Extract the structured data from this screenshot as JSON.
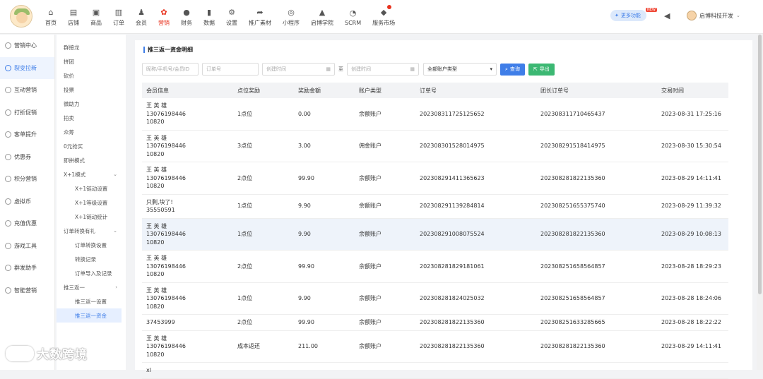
{
  "nav": [
    {
      "label": "首页",
      "icon": "home-icon",
      "glyph": "⌂"
    },
    {
      "label": "店铺",
      "icon": "store-icon",
      "glyph": "▤"
    },
    {
      "label": "商品",
      "icon": "goods-icon",
      "glyph": "▣"
    },
    {
      "label": "订单",
      "icon": "order-icon",
      "glyph": "▥"
    },
    {
      "label": "会员",
      "icon": "member-icon",
      "glyph": "♟"
    },
    {
      "label": "营销",
      "icon": "marketing-icon",
      "glyph": "✿",
      "active": true
    },
    {
      "label": "财务",
      "icon": "finance-icon",
      "glyph": "●"
    },
    {
      "label": "数据",
      "icon": "data-icon",
      "glyph": "▮"
    },
    {
      "label": "设置",
      "icon": "settings-icon",
      "glyph": "⚙"
    },
    {
      "label": "推广素材",
      "icon": "share-icon",
      "glyph": "➦"
    },
    {
      "label": "小程序",
      "icon": "miniapp-icon",
      "glyph": "◎"
    },
    {
      "label": "启博学院",
      "icon": "academy-icon",
      "glyph": "▲"
    },
    {
      "label": "SCRM",
      "icon": "scrm-icon",
      "glyph": "◔"
    },
    {
      "label": "服务市场",
      "icon": "service-market-icon",
      "glyph": "◆"
    }
  ],
  "header": {
    "more": "更多功能",
    "new": "NEW",
    "user": "启博科技开发"
  },
  "sidebar": [
    {
      "label": "营销中心"
    },
    {
      "label": "裂变拉新",
      "active": true
    },
    {
      "label": "互动营销"
    },
    {
      "label": "打折促销"
    },
    {
      "label": "客单提升"
    },
    {
      "label": "优惠券"
    },
    {
      "label": "积分营销"
    },
    {
      "label": "虚拟币"
    },
    {
      "label": "充值优惠"
    },
    {
      "label": "游戏工具"
    },
    {
      "label": "群发助手"
    },
    {
      "label": "智能营销"
    }
  ],
  "subnav": [
    {
      "label": "群接龙"
    },
    {
      "label": "拼团"
    },
    {
      "label": "砍价"
    },
    {
      "label": "投票"
    },
    {
      "label": "微助力"
    },
    {
      "label": "拍卖"
    },
    {
      "label": "众筹"
    },
    {
      "label": "0元抢买"
    },
    {
      "label": "即拼模式"
    },
    {
      "label": "X+1模式",
      "chev": "⌄"
    },
    {
      "label": "X+1链动设置",
      "child": true
    },
    {
      "label": "X+1等级设置",
      "child": true
    },
    {
      "label": "X+1链动统计",
      "child": true
    },
    {
      "label": "订单转换有礼",
      "chev": "⌄"
    },
    {
      "label": "订单转换设置",
      "child": true
    },
    {
      "label": "转换记录",
      "child": true
    },
    {
      "label": "订单导入及记录",
      "child": true
    },
    {
      "label": "推三返一",
      "chev": "›"
    },
    {
      "label": "推三返一设置",
      "child": true
    },
    {
      "label": "推三返一资金",
      "child": true,
      "active": true
    }
  ],
  "page": {
    "title": "推三返一资金明细",
    "filters": {
      "member_placeholder": "昵称/手机号/会员ID",
      "order_placeholder": "订单号",
      "start_placeholder": "创建时间",
      "to": "至",
      "end_placeholder": "创建时间",
      "account_type": "全部账户类型",
      "search": "查询",
      "export": "导出"
    },
    "columns": [
      "会员信息",
      "点位奖励",
      "奖励金额",
      "账户类型",
      "订单号",
      "团长订单号",
      "交易时间"
    ],
    "rows": [
      {
        "member": [
          "王 英 雄",
          "13076198446",
          "10820"
        ],
        "level": "1点位",
        "amount": "0.00",
        "account": "余额账户",
        "order": "20230831172512565 2",
        "leader": "20230831171046543 7",
        "time": "2023-08-31 17:25:16"
      },
      {
        "member": [
          "王 英 雄",
          "13076198446",
          "10820"
        ],
        "level": "3点位",
        "amount": "3.00",
        "account": "佣金账户",
        "order": "20230830152801497 5",
        "leader": "20230829151841497 5",
        "time": "2023-08-30 15:30:54"
      },
      {
        "member": [
          "王 英 雄",
          "13076198446",
          "10820"
        ],
        "level": "2点位",
        "amount": "99.90",
        "account": "余额账户",
        "order": "20230829141136562 3",
        "leader": "20230828182213536 0",
        "time": "2023-08-29 14:11:41"
      },
      {
        "member": [
          "只剩,块了!",
          "35550591"
        ],
        "level": "1点位",
        "amount": "9.90",
        "account": "余额账户",
        "order": "20230829113928481 4",
        "leader": "20230825165537574 0",
        "time": "2023-08-29 11:39:32"
      },
      {
        "member": [
          "王 英 雄",
          "13076198446",
          "10820"
        ],
        "level": "1点位",
        "amount": "9.90",
        "account": "余额账户",
        "order": "20230829100807552 4",
        "leader": "20230828182213536 0",
        "time": "2023-08-29 10:08:13",
        "hl": true
      },
      {
        "member": [
          "王 英 雄",
          "13076198446",
          "10820"
        ],
        "level": "2点位",
        "amount": "99.90",
        "account": "余额账户",
        "order": "20230828182918106 1",
        "leader": "20230825165856485 7",
        "time": "2023-08-28 18:29:23"
      },
      {
        "member": [
          "王 英 雄",
          "13076198446",
          "10820"
        ],
        "level": "1点位",
        "amount": "9.90",
        "account": "余额账户",
        "order": "20230828182402503 2",
        "leader": "20230825165856485 7",
        "time": "2023-08-28 18:24:06"
      },
      {
        "member": [
          "37453999"
        ],
        "level": "2点位",
        "amount": "99.90",
        "account": "余额账户",
        "order": "20230828182213536 0",
        "leader": "20230825163328566 5",
        "time": "2023-08-28 18:22:22"
      },
      {
        "member": [
          "王 英 雄",
          "13076198446",
          "10820"
        ],
        "level": "成本返还",
        "amount": "211.00",
        "account": "余额账户",
        "order": "20230828182213536 0",
        "leader": "20230828182213536 0",
        "time": "2023-08-29 14:11:41"
      },
      {
        "member": [
          "xl"
        ],
        "level": "",
        "amount": "",
        "account": "",
        "order": "",
        "leader": "",
        "time": ""
      }
    ]
  },
  "watermark": "大数跨境"
}
